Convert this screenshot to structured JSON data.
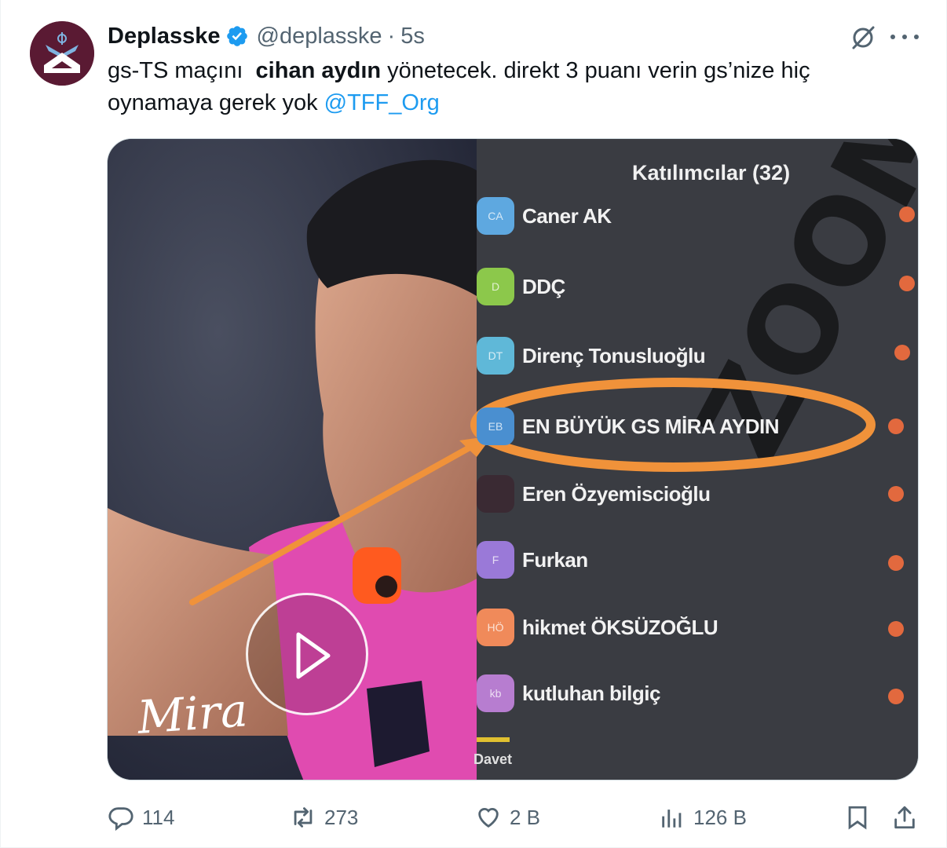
{
  "tweet": {
    "display_name": "Deplasske",
    "handle": "@deplasske",
    "separator": "·",
    "time": "5s",
    "text_before": "gs-TS maçını  ",
    "text_bold": "cihan aydın",
    "text_after": " yönetecek. direkt 3 puanı verin gs’nize hiç oynamaya gerek yok ",
    "mention": "@TFF_Org"
  },
  "media": {
    "panel_title": "Katılımcılar (32)",
    "participants": [
      {
        "initials": "CA",
        "name": "Caner AK",
        "color": "#5ea8e0"
      },
      {
        "initials": "D",
        "name": "DDÇ",
        "color": "#8cc84b"
      },
      {
        "initials": "DT",
        "name": "Direnç Tonusluoğlu",
        "color": "#5fb8d8"
      },
      {
        "initials": "EB",
        "name": "EN BÜYÜK GS MİRA AYDIN",
        "color": "#4a8fd0"
      },
      {
        "initials": "",
        "name": "Eren Özyemiscioğlu",
        "color": "#3a2a33"
      },
      {
        "initials": "F",
        "name": "Furkan",
        "color": "#9a79d8"
      },
      {
        "initials": "HÖ",
        "name": "hikmet ÖKSÜZOĞLU",
        "color": "#f08a5a"
      },
      {
        "initials": "kb",
        "name": "kutluhan bilgiç",
        "color": "#b77dd0"
      }
    ],
    "invite_label": "Davet",
    "watermark": "Mira"
  },
  "actions": {
    "replies": "114",
    "reposts": "273",
    "likes": "2 B",
    "views": "126 B"
  },
  "icons": {
    "verified": "verified-badge-icon",
    "grok": "grok-icon",
    "more": "more-icon",
    "reply": "reply-icon",
    "repost": "repost-icon",
    "like": "like-icon",
    "views": "views-icon",
    "bookmark": "bookmark-icon",
    "share": "share-icon",
    "play": "play-icon"
  },
  "colors": {
    "accent": "#1d9bf0",
    "secondary_text": "#536471",
    "annotation_orange": "#f0923a"
  }
}
